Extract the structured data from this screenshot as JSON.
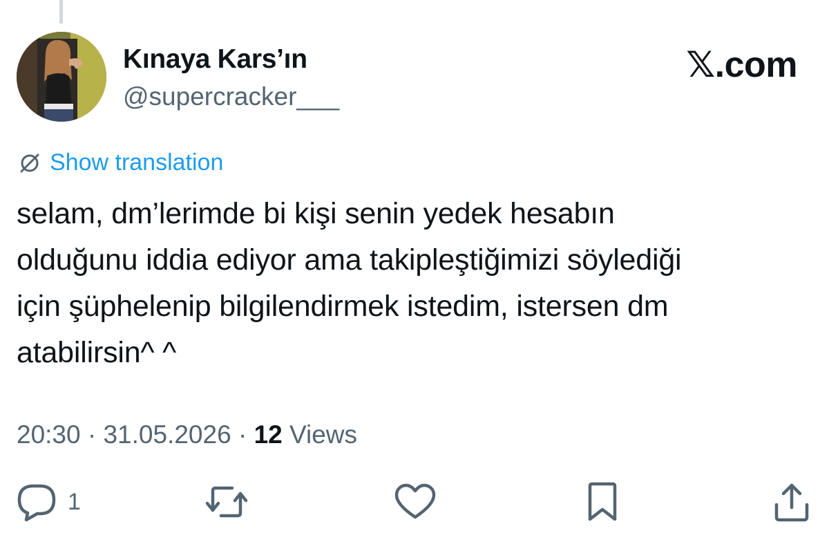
{
  "author": {
    "display_name": "Kınaya Kars’ın",
    "handle": "@supercracker___"
  },
  "brand": "𝕏.com",
  "translate": {
    "label": "Show translation",
    "icon": "globe-slash-icon"
  },
  "tweet": {
    "lines": [
      "selam, dm’lerimde bi kişi senin yedek hesabın",
      "olduğunu iddia ediyor ama takipleştiğimizi söylediği",
      "için şüphelenip bilgilendirmek istedim, istersen dm",
      "atabilirsin^ ^"
    ]
  },
  "meta": {
    "time": "20:30",
    "date": "31.05.2026",
    "views_count": "12",
    "views_label": "Views",
    "separator": " · "
  },
  "actions": {
    "reply": {
      "icon": "reply-icon",
      "count": "1"
    },
    "repost": {
      "icon": "repost-icon"
    },
    "like": {
      "icon": "heart-icon"
    },
    "bookmark": {
      "icon": "bookmark-icon"
    },
    "share": {
      "icon": "share-icon"
    }
  },
  "colors": {
    "link": "#1d9bf0",
    "secondary_text": "#536471",
    "primary_text": "#0f1419",
    "background": "#ffffff"
  }
}
